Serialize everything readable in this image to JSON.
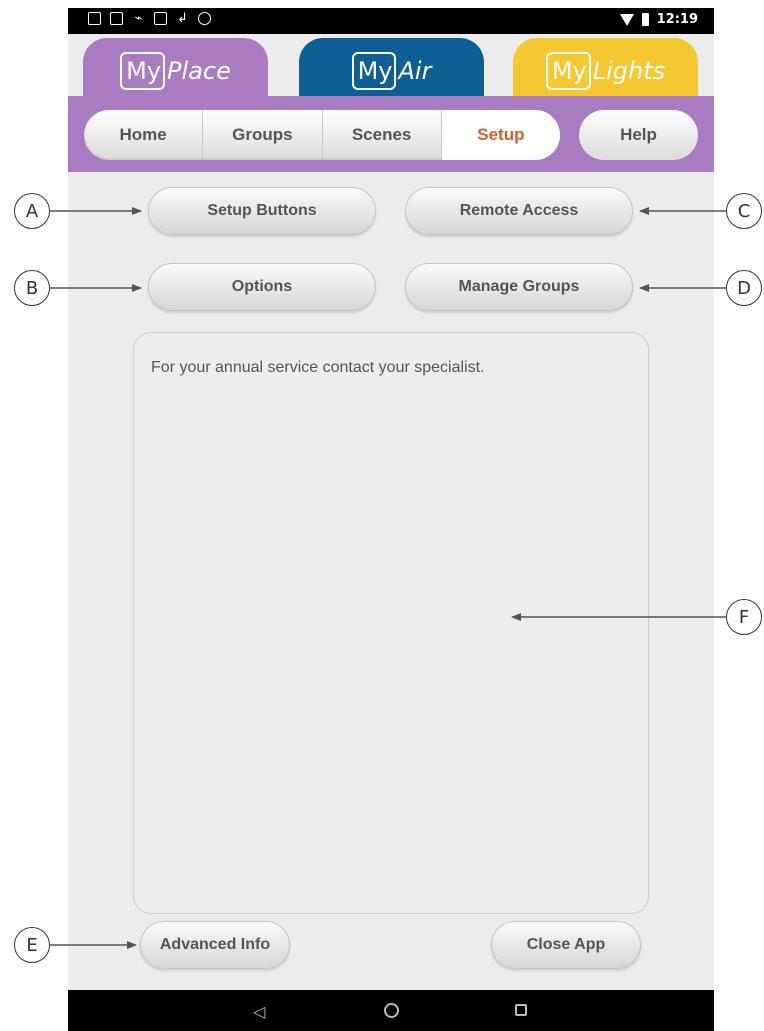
{
  "status_bar": {
    "time": "12:19",
    "left_icons": [
      "myplace-notification-icon",
      "myplace-notification-icon",
      "usb-icon",
      "gallery-icon",
      "data-saver-icon",
      "info-icon"
    ],
    "right_icons": [
      "wifi-icon",
      "battery-icon"
    ]
  },
  "brand_tabs": [
    {
      "prefix": "My",
      "suffix": "Place",
      "color": "#a97cc1"
    },
    {
      "prefix": "My",
      "suffix": "Air",
      "color": "#0e5f94"
    },
    {
      "prefix": "My",
      "suffix": "Lights",
      "color": "#f5c731"
    }
  ],
  "nav": {
    "tabs": [
      "Home",
      "Groups",
      "Scenes",
      "Setup"
    ],
    "active_tab": "Setup",
    "help_label": "Help",
    "accent_color": "#d0602d"
  },
  "setup": {
    "setup_buttons_label": "Setup Buttons",
    "remote_access_label": "Remote Access",
    "options_label": "Options",
    "manage_groups_label": "Manage Groups",
    "info_text": "For your annual service contact your specialist.",
    "advanced_info_label": "Advanced Info",
    "close_app_label": "Close App"
  },
  "callouts": {
    "a": "A",
    "b": "B",
    "c": "C",
    "d": "D",
    "e": "E",
    "f": "F"
  },
  "system_nav": {
    "back_icon": "back-icon",
    "home_icon": "home-icon",
    "recents_icon": "recents-icon"
  }
}
